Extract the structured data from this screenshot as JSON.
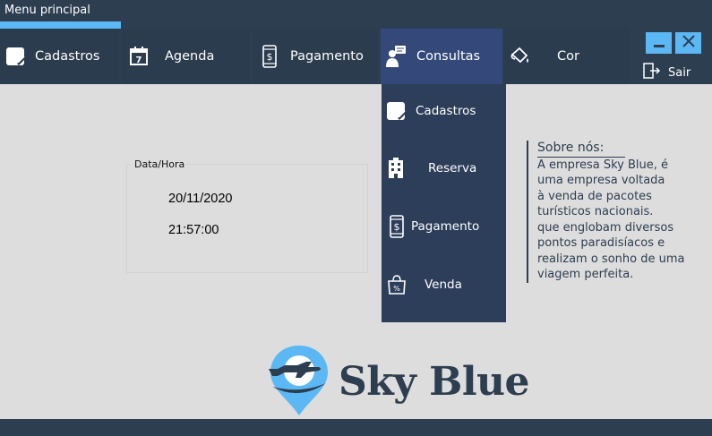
{
  "window": {
    "title": "Menu principal"
  },
  "menu": {
    "items": [
      {
        "label": "Cadastros",
        "icon": "edit-note-icon"
      },
      {
        "label": "Agenda",
        "icon": "calendar-icon"
      },
      {
        "label": "Pagamento",
        "icon": "phone-payment-icon"
      },
      {
        "label": "Consultas",
        "icon": "consult-person-icon",
        "active": true
      },
      {
        "label": "Cor",
        "icon": "paint-bucket-icon"
      }
    ]
  },
  "window_controls": {
    "minimize": "minimize-icon",
    "close": "close-icon",
    "exit_label": "Sair"
  },
  "dropdown": {
    "items": [
      {
        "label": "Cadastros",
        "icon": "edit-note-icon"
      },
      {
        "label": "Reserva",
        "icon": "building-icon"
      },
      {
        "label": "Pagamento",
        "icon": "phone-payment-icon"
      },
      {
        "label": "Venda",
        "icon": "shopping-bag-icon"
      }
    ]
  },
  "datetime": {
    "label": "Data/Hora",
    "date": "20/11/2020",
    "time": "21:57:00"
  },
  "about": {
    "title": "Sobre nós:",
    "lines": [
      "A empresa Sky Blue, é",
      "uma empresa voltada",
      "à venda de pacotes",
      "turísticos nacionais.",
      "que englobam diversos",
      "pontos paradisíacos e",
      "realizam o sonho de uma",
      "viagem perfeita."
    ]
  },
  "brand": {
    "name": "Sky Blue",
    "logo_icon": "airplane-pin-logo-icon"
  },
  "colors": {
    "dark_navy": "#2d3e50",
    "accent_blue": "#5bb8f5",
    "active_menu": "#34497a",
    "background": "#dddddd"
  }
}
